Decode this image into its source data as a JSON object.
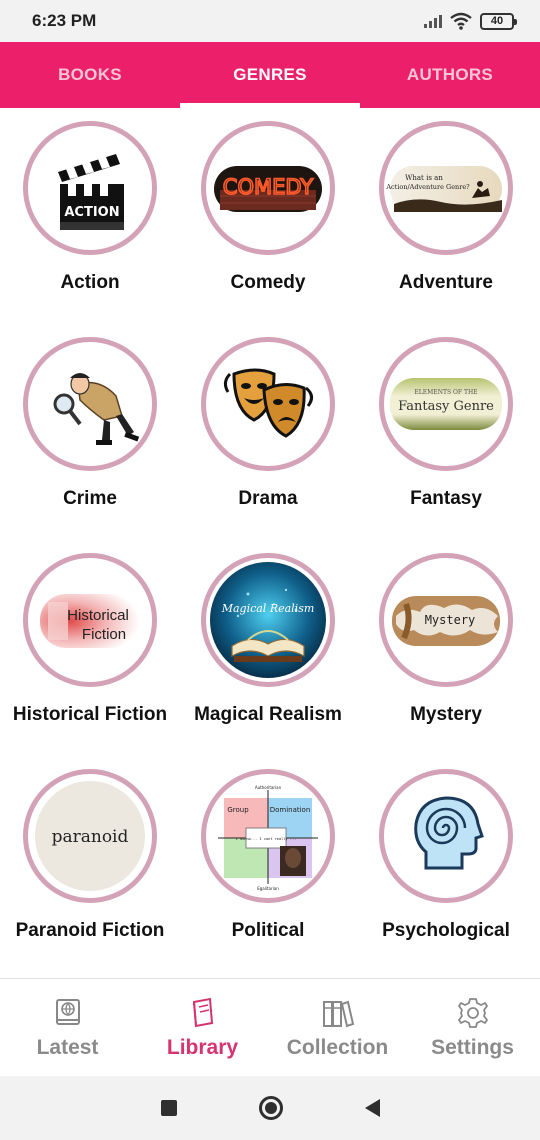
{
  "status_bar": {
    "time": "6:23 PM",
    "battery": "40"
  },
  "tabs": [
    {
      "label": "BOOKS",
      "active": false
    },
    {
      "label": "GENRES",
      "active": true
    },
    {
      "label": "AUTHORS",
      "active": false
    }
  ],
  "genres": [
    {
      "label": "Action",
      "icon": "clapperboard-icon"
    },
    {
      "label": "Comedy",
      "icon": "comedy-sign-icon"
    },
    {
      "label": "Adventure",
      "icon": "adventure-banner-icon"
    },
    {
      "label": "Crime",
      "icon": "detective-icon"
    },
    {
      "label": "Drama",
      "icon": "theater-masks-icon"
    },
    {
      "label": "Fantasy",
      "icon": "fantasy-banner-icon"
    },
    {
      "label": "Historical Fiction",
      "icon": "historical-fiction-icon"
    },
    {
      "label": "Magical Realism",
      "icon": "magic-book-icon"
    },
    {
      "label": "Mystery",
      "icon": "torn-paper-icon"
    },
    {
      "label": "Paranoid Fiction",
      "icon": "paranoid-text-icon"
    },
    {
      "label": "Political",
      "icon": "political-compass-icon"
    },
    {
      "label": "Psychological",
      "icon": "spiral-head-icon"
    }
  ],
  "genre_art_text": {
    "action": "ACTION",
    "comedy": "COMEDY",
    "adventure_line1": "What is an",
    "adventure_line2": "Action/Adventure Genre?",
    "fantasy_small": "ELEMENTS OF THE",
    "fantasy": "Fantasy Genre",
    "historical_line1": "Historical",
    "historical_line2": "Fiction",
    "magical": "Magical Realism",
    "mystery": "Mystery",
    "paranoid": "paranoid",
    "political_top": "Authoritarian",
    "political_left": "Group",
    "political_right": "Domination",
    "political_center": "I dunno... I cant really ...",
    "political_bottom": "Egalitarian"
  },
  "bottom_nav": [
    {
      "label": "Latest",
      "icon": "book-globe-icon",
      "active": false
    },
    {
      "label": "Library",
      "icon": "book-icon",
      "active": true
    },
    {
      "label": "Collection",
      "icon": "bookshelf-icon",
      "active": false
    },
    {
      "label": "Settings",
      "icon": "gear-icon",
      "active": false
    }
  ],
  "colors": {
    "accent": "#ec1f6a",
    "ring": "#d3a2b7",
    "active_nav": "#d6336f"
  }
}
